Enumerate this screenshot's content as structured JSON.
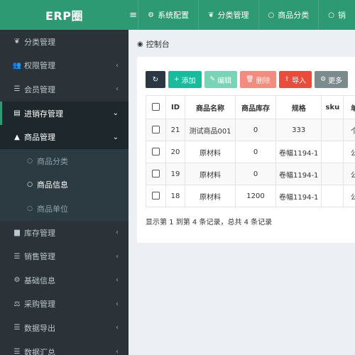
{
  "app": {
    "logo": "ERP圈"
  },
  "topbar": {
    "menu_glyph": "≡",
    "tabs": [
      {
        "icon": "gear-icon",
        "glyph": "⚙",
        "label": "系统配置"
      },
      {
        "icon": "leaf-icon",
        "glyph": "❦",
        "label": "分类管理"
      },
      {
        "icon": "circle-icon",
        "glyph": "○",
        "label": "商品分类"
      },
      {
        "icon": "circle-icon",
        "glyph": "○",
        "label": "销"
      }
    ]
  },
  "sidebar": {
    "items": [
      {
        "icon": "leaf-icon",
        "glyph": "❦",
        "label": "分类管理",
        "caret": ""
      },
      {
        "icon": "users-icon",
        "glyph": "👥",
        "label": "权限管理",
        "caret": "‹"
      },
      {
        "icon": "list-icon",
        "glyph": "☰",
        "label": "会员管理",
        "caret": "‹"
      },
      {
        "icon": "file-icon",
        "glyph": "▤",
        "label": "进销存管理",
        "caret": "⌄"
      },
      {
        "icon": "box-icon",
        "glyph": "▲",
        "label": "商品管理",
        "caret": "⌄"
      },
      {
        "icon": "circle-icon",
        "glyph": "○",
        "label": "商品分类",
        "caret": ""
      },
      {
        "icon": "circle-icon",
        "glyph": "○",
        "label": "商品信息",
        "caret": ""
      },
      {
        "icon": "circle-icon",
        "glyph": "○",
        "label": "商品单位",
        "caret": ""
      },
      {
        "icon": "archive-icon",
        "glyph": "▆",
        "label": "库存管理",
        "caret": "‹"
      },
      {
        "icon": "list-icon",
        "glyph": "☰",
        "label": "销售管理",
        "caret": "‹"
      },
      {
        "icon": "cogs-icon",
        "glyph": "⚙",
        "label": "基础信息",
        "caret": "‹"
      },
      {
        "icon": "scale-icon",
        "glyph": "⚖",
        "label": "采购管理",
        "caret": "‹"
      },
      {
        "icon": "list-icon",
        "glyph": "☰",
        "label": "数据导出",
        "caret": "‹"
      },
      {
        "icon": "list-icon",
        "glyph": "☰",
        "label": "数据汇总",
        "caret": "‹"
      }
    ]
  },
  "breadcrumb": {
    "icon": "dashboard-icon",
    "glyph": "◉",
    "label": "控制台"
  },
  "toolbar": {
    "refresh_glyph": "↻",
    "add": {
      "glyph": "+",
      "label": "添加"
    },
    "edit": {
      "glyph": "✎",
      "label": "编辑"
    },
    "delete": {
      "glyph": "🗑",
      "label": "删除"
    },
    "import": {
      "glyph": "⇪",
      "label": "导入"
    },
    "more": {
      "glyph": "⚙",
      "label": "更多"
    }
  },
  "table": {
    "headers": [
      "ID",
      "商品名称",
      "商品库存",
      "规格",
      "sku",
      "单"
    ],
    "rows": [
      [
        "21",
        "测试商品001",
        "0",
        "333",
        "",
        "个"
      ],
      [
        "20",
        "原材料",
        "0",
        "卷幅1194-1",
        "",
        "公"
      ],
      [
        "19",
        "原材料",
        "0",
        "卷幅1194-1",
        "",
        "公"
      ],
      [
        "18",
        "原材料",
        "1200",
        "卷幅1194-1",
        "",
        "公"
      ]
    ]
  },
  "pagination": {
    "summary": "显示第 1 到第 4 条记录，总共 4 条记录"
  },
  "colors": {
    "brand": "#2e9a73",
    "sidebar_bg": "#2b3338",
    "btn_add": "#18bc9c",
    "btn_delete": "#f18c7e",
    "btn_import": "#e74c3c"
  }
}
